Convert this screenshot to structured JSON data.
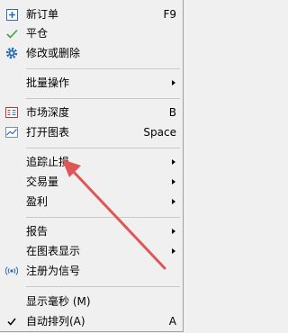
{
  "menu": {
    "items": [
      {
        "label": "新订单",
        "shortcut": "F9",
        "icon": "new-order-icon"
      },
      {
        "label": "平仓",
        "icon": "check-icon"
      },
      {
        "label": "修改或删除",
        "icon": "gear-icon"
      },
      {
        "label": "批量操作",
        "submenu": true
      },
      {
        "label": "市场深度",
        "shortcut": "B",
        "icon": "market-depth-icon"
      },
      {
        "label": "打开图表",
        "shortcut": "Space",
        "icon": "chart-icon"
      },
      {
        "label": "追踪止损",
        "submenu": true
      },
      {
        "label": "交易量",
        "submenu": true
      },
      {
        "label": "盈利",
        "submenu": true
      },
      {
        "label": "报告",
        "submenu": true
      },
      {
        "label": "在图表显示",
        "submenu": true
      },
      {
        "label": "注册为信号",
        "icon": "signal-icon"
      },
      {
        "label": "显示毫秒 (M)"
      },
      {
        "label": "自动排列(A)",
        "shortcut": "A",
        "checked": true
      }
    ]
  },
  "colors": {
    "menu_bg": "#f0f0f0",
    "accent_blue": "#2a6db5",
    "check_green": "#3aa63a",
    "annotation_red": "#e05555"
  }
}
